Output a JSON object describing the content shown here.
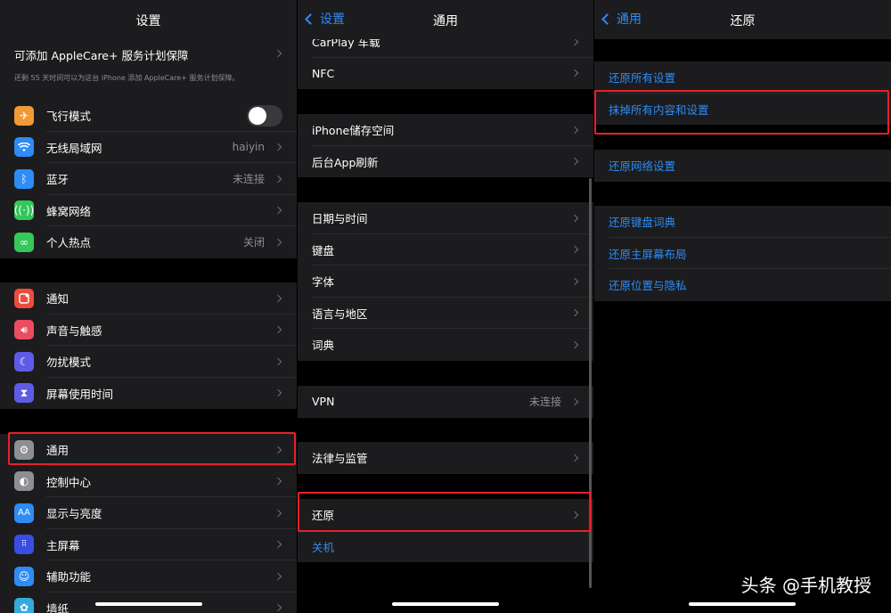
{
  "panel1": {
    "title": "设置",
    "applecare": {
      "title": "可添加 AppleCare+ 服务计划保障",
      "subtitle": "还剩 55 天时间可以为这台 iPhone 添加 AppleCare+ 服务计划保障。"
    },
    "group1": [
      {
        "label": "飞行模式",
        "icon": "airplane-icon",
        "color": "#f09a37",
        "toggle": true
      },
      {
        "label": "无线局域网",
        "icon": "wifi-icon",
        "color": "#2d8cf5",
        "value": "haiyin"
      },
      {
        "label": "蓝牙",
        "icon": "bluetooth-icon",
        "color": "#2d8cf5",
        "value": "未连接"
      },
      {
        "label": "蜂窝网络",
        "icon": "cellular-icon",
        "color": "#34c759"
      },
      {
        "label": "个人热点",
        "icon": "hotspot-icon",
        "color": "#34c759",
        "value": "关闭"
      }
    ],
    "group2": [
      {
        "label": "通知",
        "icon": "notifications-icon",
        "color": "#eb4d3d"
      },
      {
        "label": "声音与触感",
        "icon": "sound-icon",
        "color": "#eb4d5f"
      },
      {
        "label": "勿扰模式",
        "icon": "moon-icon",
        "color": "#5e5ce6"
      },
      {
        "label": "屏幕使用时间",
        "icon": "hourglass-icon",
        "color": "#5e5ce6"
      }
    ],
    "group3": [
      {
        "label": "通用",
        "icon": "gear-icon",
        "color": "#8e8e93"
      },
      {
        "label": "控制中心",
        "icon": "control-center-icon",
        "color": "#8e8e93"
      },
      {
        "label": "显示与亮度",
        "icon": "display-icon",
        "color": "#2d8cf5"
      },
      {
        "label": "主屏幕",
        "icon": "home-screen-icon",
        "color": "#3a4de0"
      },
      {
        "label": "辅助功能",
        "icon": "accessibility-icon",
        "color": "#2d8cf5"
      },
      {
        "label": "墙纸",
        "icon": "wallpaper-icon",
        "color": "#35aadc"
      }
    ]
  },
  "panel2": {
    "back": "设置",
    "title": "通用",
    "group0": [
      {
        "label": "CarPlay 车载"
      },
      {
        "label": "NFC"
      }
    ],
    "group1": [
      {
        "label": "iPhone储存空间"
      },
      {
        "label": "后台App刷新"
      }
    ],
    "group2": [
      {
        "label": "日期与时间"
      },
      {
        "label": "键盘"
      },
      {
        "label": "字体"
      },
      {
        "label": "语言与地区"
      },
      {
        "label": "词典"
      }
    ],
    "group3": [
      {
        "label": "VPN",
        "value": "未连接"
      }
    ],
    "group4": [
      {
        "label": "法律与监管"
      }
    ],
    "group5": [
      {
        "label": "还原"
      },
      {
        "label": "关机"
      }
    ]
  },
  "panel3": {
    "back": "通用",
    "title": "还原",
    "group1": [
      {
        "label": "还原所有设置"
      },
      {
        "label": "抹掉所有内容和设置"
      }
    ],
    "group2": [
      {
        "label": "还原网络设置"
      }
    ],
    "group3": [
      {
        "label": "还原键盘词典"
      },
      {
        "label": "还原主屏幕布局"
      },
      {
        "label": "还原位置与隐私"
      }
    ]
  },
  "watermark": "头条 @手机教授"
}
